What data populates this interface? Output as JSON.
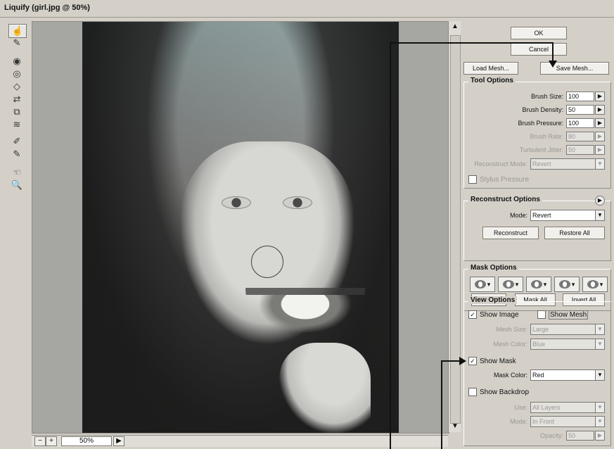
{
  "window": {
    "title": "Liquify (girl.jpg @ 50%)"
  },
  "tools": [
    "forward-warp",
    "reconstruct",
    "twirl-clockwise",
    "pucker",
    "bloat",
    "push-left",
    "mirror",
    "turbulence",
    "freeze-mask",
    "thaw-mask",
    "hand",
    "zoom"
  ],
  "buttons": {
    "ok": "OK",
    "cancel": "Cancel",
    "load_mesh": "Load Mesh...",
    "save_mesh": "Save Mesh..."
  },
  "tool_options": {
    "title": "Tool Options",
    "brush_size_label": "Brush Size:",
    "brush_size": "100",
    "brush_density_label": "Brush Density:",
    "brush_density": "50",
    "brush_pressure_label": "Brush Pressure:",
    "brush_pressure": "100",
    "brush_rate_label": "Brush Rate:",
    "brush_rate": "80",
    "turbulent_jitter_label": "Turbulent Jitter:",
    "turbulent_jitter": "50",
    "reconstruct_mode_label": "Reconstruct Mode:",
    "reconstruct_mode": "Revert",
    "stylus_pressure_label": "Stylus Pressure"
  },
  "reconstruct_options": {
    "title": "Reconstruct Options",
    "mode_label": "Mode:",
    "mode": "Revert",
    "reconstruct_button": "Reconstruct",
    "restore_all_button": "Restore All"
  },
  "mask_options": {
    "title": "Mask Options",
    "none_button": "None",
    "mask_all_button": "Mask All",
    "invert_all_button": "Invert All"
  },
  "view_options": {
    "title": "View Options",
    "show_image_label": "Show Image",
    "show_mesh_label": "Show Mesh",
    "mesh_size_label": "Mesh Size:",
    "mesh_size": "Large",
    "mesh_color_label": "Mesh Color:",
    "mesh_color": "Blue",
    "show_mask_label": "Show Mask",
    "mask_color_label": "Mask Color:",
    "mask_color": "Red",
    "show_backdrop_label": "Show Backdrop",
    "use_label": "Use:",
    "use": "All Layers",
    "mode_label": "Mode:",
    "mode": "In Front",
    "opacity_label": "Opacity:",
    "opacity": "50"
  },
  "status": {
    "zoom": "50%"
  }
}
